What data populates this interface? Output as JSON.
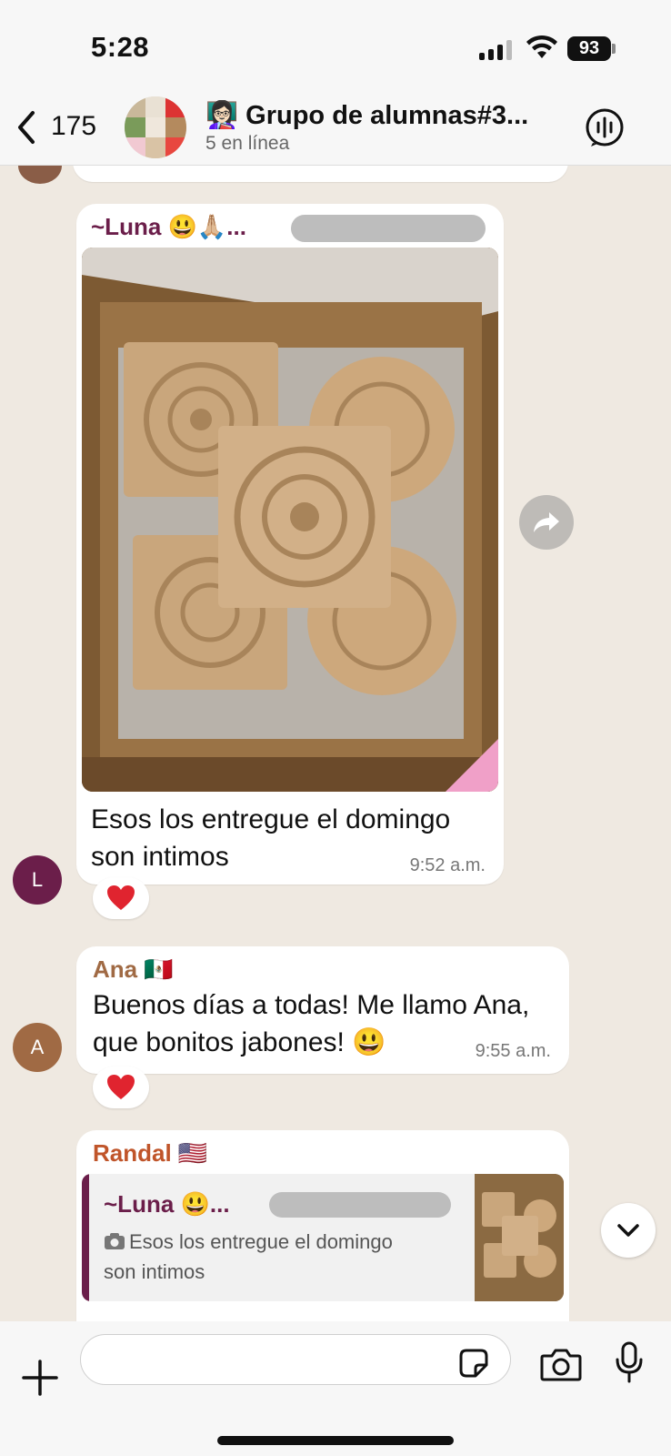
{
  "status_bar": {
    "time": "5:28",
    "battery": "93"
  },
  "header": {
    "back_count": "175",
    "title": "👩🏻‍🏫 Grupo de alumnas#3...",
    "subtitle": "5 en línea",
    "icons": [
      "chevron-left-icon",
      "group-call-icon"
    ]
  },
  "messages": [
    {
      "sender": "~Luna 😃🙏🏼...",
      "sender_color": "#6b1e4a",
      "avatar_letter": "L",
      "avatar_color": "#6b1e4a",
      "has_photo": true,
      "text_lines": [
        "Esos los entregue el domingo",
        "son intimos"
      ],
      "time": "9:52 a.m.",
      "reaction": "❤️"
    },
    {
      "sender": "Ana 🇲🇽",
      "sender_color": "#a06a44",
      "avatar_letter": "A",
      "avatar_color": "#a06a44",
      "text_lines": [
        "Buenos días a todas! Me llamo Ana,",
        "que bonitos jabones! 😃"
      ],
      "time": "9:55 a.m.",
      "reaction": "❤️"
    },
    {
      "sender": "Randal 🇺🇸",
      "sender_color": "#c0552a",
      "quote": {
        "sender": "~Luna 😃...",
        "text_lines": [
          "Esos los entregue el domingo",
          "son intimos"
        ]
      }
    }
  ],
  "input": {
    "placeholder": ""
  },
  "colors": {
    "chat_background": "#efe9e1",
    "bubble": "#ffffff",
    "header_background": "#f7f7f7"
  }
}
